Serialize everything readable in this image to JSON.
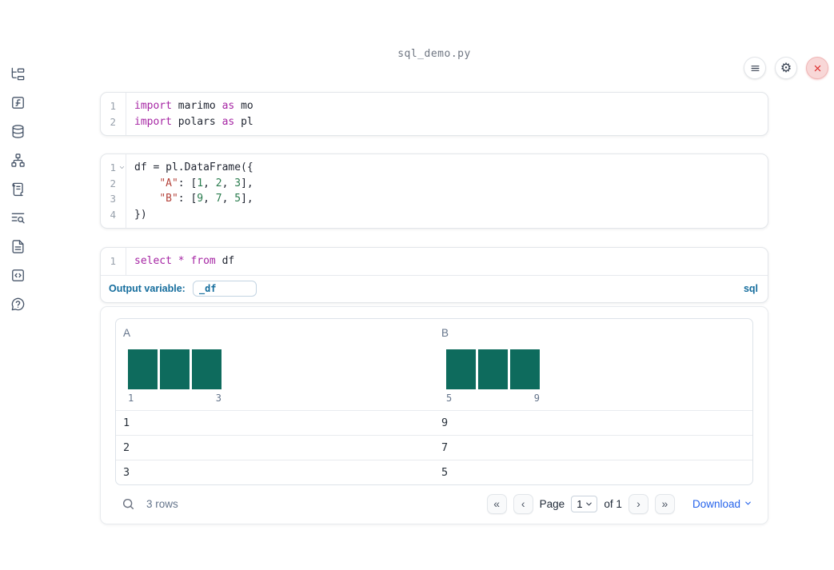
{
  "window": {
    "filename": "sql_demo.py"
  },
  "topbar": {
    "icons": [
      "menu-icon",
      "settings-gear-icon",
      "close-icon"
    ]
  },
  "sidebar": {
    "icons": [
      "file-tree-icon",
      "function-square-icon",
      "database-icon",
      "dependency-graph-icon",
      "scroll-text-icon",
      "logs-search-icon",
      "snippets-icon",
      "code-square-icon",
      "help-icon"
    ]
  },
  "cells": {
    "cell1": {
      "lines": [
        {
          "num": "1",
          "tokens": [
            "import",
            " marimo ",
            "as",
            " mo"
          ]
        },
        {
          "num": "2",
          "tokens": [
            "import",
            " polars ",
            "as",
            " pl"
          ]
        }
      ]
    },
    "cell2": {
      "lines": [
        {
          "num": "1",
          "tokens": [
            "df = pl.DataFrame({"
          ]
        },
        {
          "num": "2",
          "tokens": [
            "    ",
            "\"A\"",
            ": [",
            "1",
            ", ",
            "2",
            ", ",
            "3",
            "],"
          ]
        },
        {
          "num": "3",
          "tokens": [
            "    ",
            "\"B\"",
            ": [",
            "9",
            ", ",
            "7",
            ", ",
            "5",
            "],"
          ]
        },
        {
          "num": "4",
          "tokens": [
            "})"
          ]
        }
      ]
    },
    "sql": {
      "lines": [
        {
          "num": "1",
          "tokens": [
            "select",
            " ",
            "*",
            " ",
            "from",
            " df"
          ]
        }
      ],
      "output_variable_label": "Output variable:",
      "output_variable_value": "_df",
      "language_badge": "sql"
    }
  },
  "table": {
    "columns": [
      {
        "name": "A",
        "hist": {
          "bar_count": 3,
          "bar_values": [
            1,
            1,
            1
          ],
          "min_label": "1",
          "max_label": "3"
        }
      },
      {
        "name": "B",
        "hist": {
          "bar_count": 3,
          "bar_values": [
            1,
            1,
            1
          ],
          "min_label": "5",
          "max_label": "9"
        }
      }
    ],
    "rows": [
      [
        "1",
        "9"
      ],
      [
        "2",
        "7"
      ],
      [
        "3",
        "5"
      ]
    ],
    "footer": {
      "row_count": "3 rows",
      "pagination": {
        "first": "«",
        "prev": "‹",
        "page_label": "Page",
        "page_value": "1",
        "of_label": "of 1",
        "next": "›",
        "last": "»"
      },
      "download_label": "Download"
    }
  },
  "colors": {
    "histogram_bar": "#0e6b5d",
    "keyword": "#a626a4",
    "string": "#b5443c",
    "number": "#2b7d4f",
    "sql_accent": "#156d9d",
    "download_link": "#2563eb",
    "close_red": "#dc2626"
  }
}
